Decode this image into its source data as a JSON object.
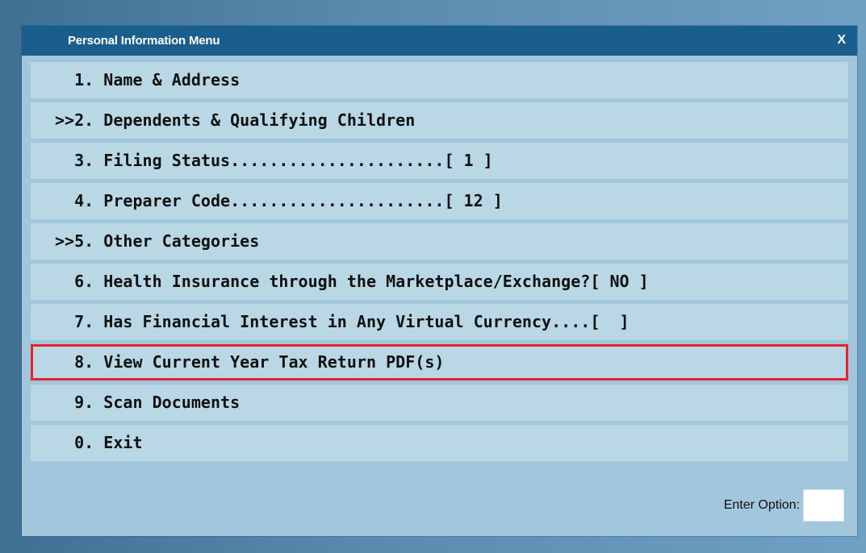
{
  "window": {
    "title": "Personal Information Menu",
    "close_label": "X"
  },
  "menu": {
    "items": [
      {
        "label": "  1. Name & Address",
        "highlighted": false
      },
      {
        "label": ">>2. Dependents & Qualifying Children",
        "highlighted": false
      },
      {
        "label": "  3. Filing Status......................[ 1 ]",
        "highlighted": false
      },
      {
        "label": "  4. Preparer Code......................[ 12 ]",
        "highlighted": false
      },
      {
        "label": ">>5. Other Categories",
        "highlighted": false
      },
      {
        "label": "  6. Health Insurance through the Marketplace/Exchange?[ NO ]",
        "highlighted": false
      },
      {
        "label": "  7. Has Financial Interest in Any Virtual Currency....[  ]",
        "highlighted": true,
        "note": ""
      },
      {
        "label": "  8. View Current Year Tax Return PDF(s)",
        "highlighted": true
      },
      {
        "label": "  9. Scan Documents",
        "highlighted": false
      },
      {
        "label": "  0. Exit",
        "highlighted": false
      }
    ]
  },
  "footer": {
    "label": "Enter Option:",
    "value": ""
  },
  "colors": {
    "background": "#5b8cb0",
    "titlebar": "#195e8c",
    "dialog": "#a2c7dc",
    "menu_row": "#b9d7e5",
    "highlight_border": "#e8202a"
  }
}
